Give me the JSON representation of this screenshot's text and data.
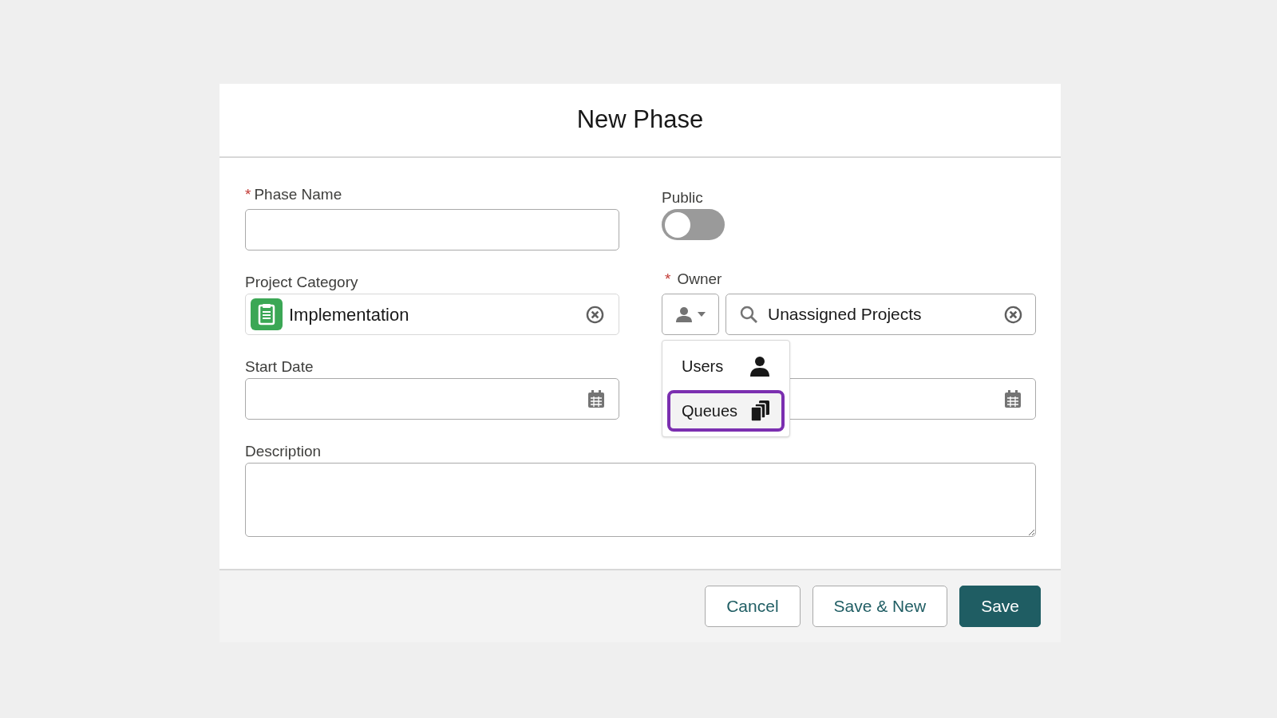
{
  "dialog": {
    "title": "New Phase"
  },
  "fields": {
    "phase_name": {
      "label": "Phase Name",
      "required": true,
      "required_mark": "*"
    },
    "public": {
      "label": "Public",
      "on": false
    },
    "project_category": {
      "label": "Project Category",
      "value": "Implementation"
    },
    "owner": {
      "label": "Owner",
      "required": true,
      "required_mark": "*",
      "value": "Unassigned Projects",
      "menu_expanded": true
    },
    "start_date": {
      "label": "Start Date"
    },
    "description": {
      "label": "Description"
    }
  },
  "owner_menu": [
    {
      "label": "Users",
      "kind": "user",
      "selected": false
    },
    {
      "label": "Queues",
      "kind": "queue",
      "selected": true
    }
  ],
  "buttons": [
    {
      "label": "Cancel",
      "kind": "neutral"
    },
    {
      "label": "Save & New",
      "kind": "neutral"
    },
    {
      "label": "Save",
      "kind": "brand"
    }
  ]
}
